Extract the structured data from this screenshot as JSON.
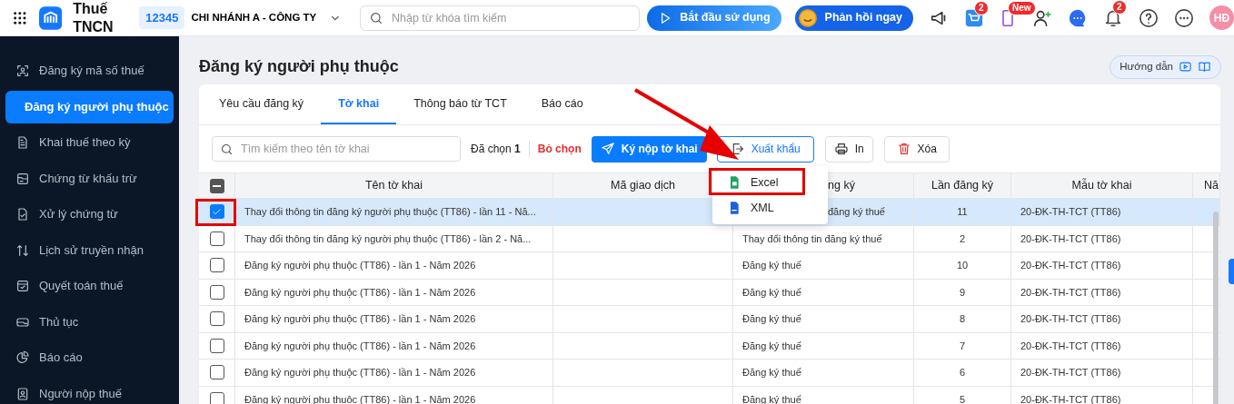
{
  "app": {
    "title": "Thuế TNCN",
    "branch_code": "12345",
    "branch_name": "CHI NHÁNH A - CÔNG TY",
    "search_placeholder": "Nhập từ khóa tìm kiếm",
    "start_button": "Bắt đầu sử dụng",
    "feedback_button": "Phản hồi ngay",
    "cart_badge": "2",
    "phone_badge": "New",
    "bell_badge": "2",
    "avatar": "HĐ"
  },
  "sidebar": {
    "items": [
      {
        "label": "Đăng ký mã số thuế",
        "selected": false
      },
      {
        "label": "Đăng ký người phụ thuộc",
        "selected": true
      },
      {
        "label": "Khai thuế theo kỳ",
        "selected": false
      },
      {
        "label": "Chứng từ khấu trừ",
        "selected": false
      },
      {
        "label": "Xử lý chứng từ",
        "selected": false
      },
      {
        "label": "Lịch sử truyền nhận",
        "selected": false
      },
      {
        "label": "Quyết toán thuế",
        "selected": false
      },
      {
        "label": "Thủ tục",
        "selected": false
      },
      {
        "label": "Báo cáo",
        "selected": false
      },
      {
        "label": "Người nộp thuế",
        "selected": false
      }
    ]
  },
  "page": {
    "title": "Đăng ký người phụ thuộc",
    "guide_button": "Hướng dẫn"
  },
  "tabs": [
    {
      "label": "Yêu cầu đăng ký",
      "selected": false
    },
    {
      "label": "Tờ khai",
      "selected": true
    },
    {
      "label": "Thông báo từ TCT",
      "selected": false
    },
    {
      "label": "Báo cáo",
      "selected": false
    }
  ],
  "toolbar": {
    "search_placeholder": "Tìm kiếm theo tên tờ khai",
    "selected_label": "Đã chọn",
    "selected_count": "1",
    "clear_selection": "Bỏ chọn",
    "buttons": [
      {
        "label": "Ký nộp tờ khai",
        "kind": "sign"
      },
      {
        "label": "Xuất khẩu",
        "kind": "export"
      },
      {
        "label": "In",
        "kind": "print"
      },
      {
        "label": "Xóa",
        "kind": "delete"
      }
    ]
  },
  "export_menu": {
    "items": [
      {
        "label": "Excel",
        "kind": "excel",
        "annotated": true
      },
      {
        "label": "XML",
        "kind": "xml",
        "annotated": false
      }
    ]
  },
  "table": {
    "select_all": {
      "indeterminate": true
    },
    "columns": [
      "Tên tờ khai",
      "Mã giao dịch",
      "ng ký",
      "Lần đăng ký",
      "Mẫu tờ khai",
      "Nă"
    ],
    "rows": [
      {
        "selected": true,
        "annotated": true,
        "cells": [
          "Thay đổi thông tin đăng ký người phụ thuộc (TT86) - lần 11 - Nă...",
          "",
          "đăng ký thuế",
          "11",
          "20-ĐK-TH-TCT (TT86)"
        ]
      },
      {
        "selected": false,
        "annotated": false,
        "cells": [
          "Thay đổi thông tin đăng ký người phụ thuộc (TT86) - lần 2 - Nă...",
          "",
          "Thay đổi thông tin đăng ký thuế",
          "2",
          "20-ĐK-TH-TCT (TT86)"
        ]
      },
      {
        "selected": false,
        "annotated": false,
        "cells": [
          "Đăng ký người phụ thuộc (TT86) - lần 1 - Năm 2026",
          "",
          "Đăng ký thuế",
          "10",
          "20-ĐK-TH-TCT (TT86)"
        ]
      },
      {
        "selected": false,
        "annotated": false,
        "cells": [
          "Đăng ký người phụ thuộc (TT86) - lần 1 - Năm 2026",
          "",
          "Đăng ký thuế",
          "9",
          "20-ĐK-TH-TCT (TT86)"
        ]
      },
      {
        "selected": false,
        "annotated": false,
        "cells": [
          "Đăng ký người phụ thuộc (TT86) - lần 1 - Năm 2026",
          "",
          "Đăng ký thuế",
          "8",
          "20-ĐK-TH-TCT (TT86)"
        ]
      },
      {
        "selected": false,
        "annotated": false,
        "cells": [
          "Đăng ký người phụ thuộc (TT86) - lần 1 - Năm 2026",
          "",
          "Đăng ký thuế",
          "7",
          "20-ĐK-TH-TCT (TT86)"
        ]
      },
      {
        "selected": false,
        "annotated": false,
        "cells": [
          "Đăng ký người phụ thuộc (TT86) - lần 1 - Năm 2026",
          "",
          "Đăng ký thuế",
          "6",
          "20-ĐK-TH-TCT (TT86)"
        ]
      },
      {
        "selected": false,
        "annotated": false,
        "cells": [
          "Đăng ký người phụ thuộc (TT86) - lần 1 - Năm 2026",
          "",
          "Đăng ký thuế",
          "5",
          "20-ĐK-TH-TCT (TT86)"
        ]
      }
    ]
  }
}
